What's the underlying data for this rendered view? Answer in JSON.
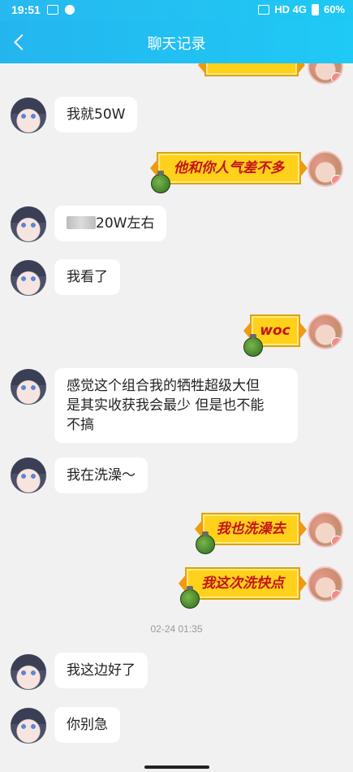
{
  "status_bar": {
    "time": "19:51",
    "network": "HD 4G",
    "battery": "60%"
  },
  "header": {
    "title": "聊天记录"
  },
  "messages": [
    {
      "from": "other",
      "text": "我就50W"
    },
    {
      "from": "self",
      "text": "他和你人气差不多"
    },
    {
      "from": "other",
      "text": "20W左右"
    },
    {
      "from": "other",
      "text": "我看了"
    },
    {
      "from": "self",
      "text": "woc"
    },
    {
      "from": "other",
      "line1": "感觉这个组合我的牺牲超级大但",
      "line2": "是其实收获我会最少 但是也不能",
      "line3": "不搞"
    },
    {
      "from": "other",
      "text": "我在洗澡～"
    },
    {
      "from": "self",
      "text": "我也洗澡去"
    },
    {
      "from": "self",
      "text": "我这次洗快点"
    },
    {
      "from": "other",
      "text": "我这边好了"
    },
    {
      "from": "other",
      "text": "你别急"
    }
  ],
  "timestamp": "02-24 01:35",
  "colors": {
    "header": "#21bff2",
    "banner_fill": "#ffd11a",
    "banner_text": "#c4121a"
  }
}
